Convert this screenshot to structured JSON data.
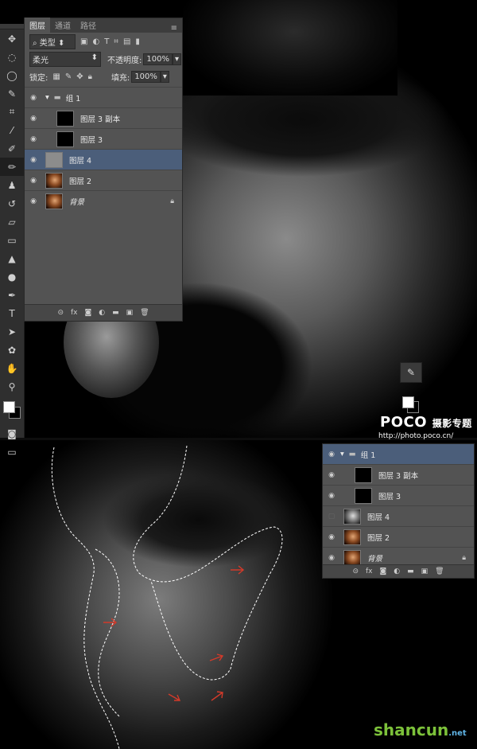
{
  "layers_panel": {
    "tabs": [
      "图层",
      "通道",
      "路径"
    ],
    "filter_label": "类型",
    "blend_mode": "柔光",
    "opacity_label": "不透明度:",
    "opacity_value": "100%",
    "lock_label": "锁定:",
    "fill_label": "填充:",
    "fill_value": "100%",
    "layers": [
      {
        "name": "组 1",
        "type": "group",
        "visible": true
      },
      {
        "name": "图层 3 副本",
        "thumb": "black",
        "visible": true
      },
      {
        "name": "图层 3",
        "thumb": "black",
        "visible": true
      },
      {
        "name": "图层 4",
        "thumb": "grey",
        "visible": true,
        "selected": true
      },
      {
        "name": "图层 2",
        "thumb": "face",
        "visible": true
      },
      {
        "name": "背景",
        "thumb": "face",
        "visible": true,
        "locked": true
      }
    ],
    "footer_icons": [
      "link-icon",
      "fx-icon",
      "mask-icon",
      "adjustment-icon",
      "folder-icon",
      "new-layer-icon",
      "trash-icon"
    ],
    "footer_fx": "fx"
  },
  "layers_panel_2": {
    "layers": [
      {
        "name": "组 1",
        "type": "group",
        "visible": true
      },
      {
        "name": "图层 3 副本",
        "thumb": "black",
        "visible": true
      },
      {
        "name": "图层 3",
        "thumb": "black",
        "visible": true
      },
      {
        "name": "图层 4",
        "thumb": "gface",
        "visible": false
      },
      {
        "name": "图层 2",
        "thumb": "face",
        "visible": true
      },
      {
        "name": "背景",
        "thumb": "face",
        "visible": true,
        "locked": true
      }
    ],
    "footer_fx": "fx"
  },
  "toolbar": {
    "tools": [
      "move-tool",
      "marquee-tool",
      "lasso-tool",
      "quick-select-tool",
      "crop-tool",
      "eyedropper-tool",
      "healing-brush-tool",
      "brush-tool",
      "clone-stamp-tool",
      "history-brush-tool",
      "eraser-tool",
      "gradient-tool",
      "blur-tool",
      "dodge-tool",
      "pen-tool",
      "type-tool",
      "path-select-tool",
      "shape-tool",
      "hand-tool",
      "zoom-tool"
    ],
    "active_tool": "brush-tool",
    "foreground_color": "#ffffff",
    "background_color": "#000000"
  },
  "watermark": {
    "poco": "POCO",
    "poco_cn": "摄影专题",
    "url": "http://photo.poco.cn/",
    "site": "shancun",
    "site_tld": ".net"
  },
  "colors": {
    "panel_bg": "#535353",
    "selected_layer": "#4b5e7a",
    "arrow": "#d23a2a"
  }
}
